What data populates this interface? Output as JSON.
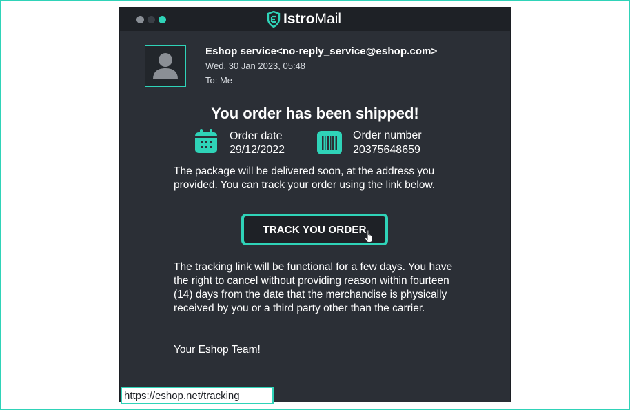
{
  "app": {
    "title_bold": "Istro",
    "title_light": "Mail",
    "accent_color": "#2fd3b8",
    "window_dots": [
      {
        "color": "#8a8f96"
      },
      {
        "color": "#3a3f46"
      },
      {
        "color": "#2fd3b8"
      }
    ]
  },
  "email": {
    "sender": "Eshop service<no-reply_service@eshop.com>",
    "date": "Wed, 30 Jan 2023, 05:48",
    "to": "To: Me",
    "avatar_icon": "user-silhouette-icon"
  },
  "body": {
    "heading": "You order has been shipped!",
    "order_date": {
      "label": "Order date",
      "value": "29/12/2022",
      "icon": "calendar-icon"
    },
    "order_number": {
      "label": "Order number",
      "value": "20375648659",
      "icon": "barcode-icon"
    },
    "paragraph1": "The package will be delivered soon, at the address you provided. You can track your order using the link below.",
    "track_button": "TRACK YOU ORDER",
    "paragraph2": "The tracking link will be functional for a few days. You have the right to cancel without providing reason within fourteen (14) days from the date that the merchandise is physically received by you or a third party other than the carrier.",
    "signoff": "Your Eshop Team!"
  },
  "status_bar": {
    "url": "https://eshop.net/tracking"
  }
}
